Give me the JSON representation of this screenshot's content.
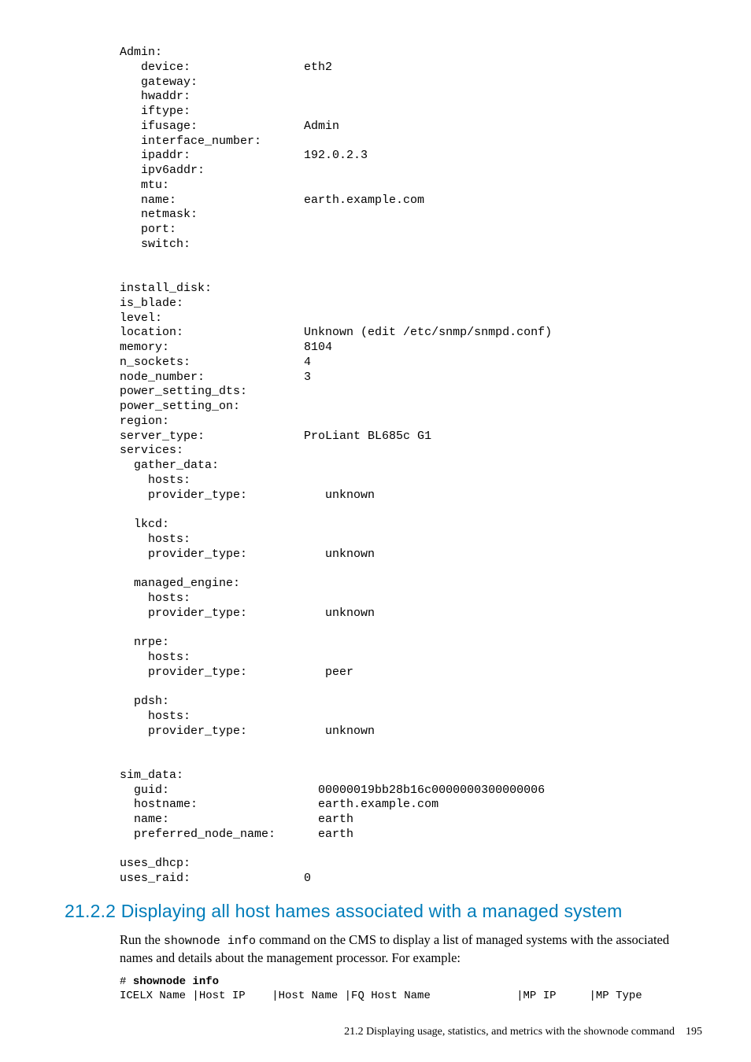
{
  "pre_main": "Admin:\n   device:                eth2\n   gateway:\n   hwaddr:\n   iftype:\n   ifusage:               Admin\n   interface_number:\n   ipaddr:                192.0.2.3\n   ipv6addr:\n   mtu:\n   name:                  earth.example.com\n   netmask:\n   port:\n   switch:\n\n\ninstall_disk:\nis_blade:\nlevel:\nlocation:                 Unknown (edit /etc/snmp/snmpd.conf)\nmemory:                   8104\nn_sockets:                4\nnode_number:              3\npower_setting_dts:\npower_setting_on:\nregion:\nserver_type:              ProLiant BL685c G1\nservices:\n  gather_data:\n    hosts:\n    provider_type:           unknown\n\n  lkcd:\n    hosts:\n    provider_type:           unknown\n\n  managed_engine:\n    hosts:\n    provider_type:           unknown\n\n  nrpe:\n    hosts:\n    provider_type:           peer\n\n  pdsh:\n    hosts:\n    provider_type:           unknown\n\n\nsim_data:\n  guid:                     00000019bb28b16c0000000300000006\n  hostname:                 earth.example.com\n  name:                     earth\n  preferred_node_name:      earth\n\nuses_dhcp:\nuses_raid:                0",
  "heading": "21.2.2 Displaying all host hames associated with a managed system",
  "para_pre": "Run the ",
  "para_code": "shownode info",
  "para_post": " command on the CMS to display a list of managed systems with the associated names and details about the management processor. For example:",
  "example_prefix": "# ",
  "example_cmd": "shownode info",
  "example_header": "ICELX Name |Host IP    |Host Name |FQ Host Name             |MP IP     |MP Type",
  "footer_text": "21.2 Displaying usage, statistics, and metrics with the shownode command",
  "footer_page": "195"
}
